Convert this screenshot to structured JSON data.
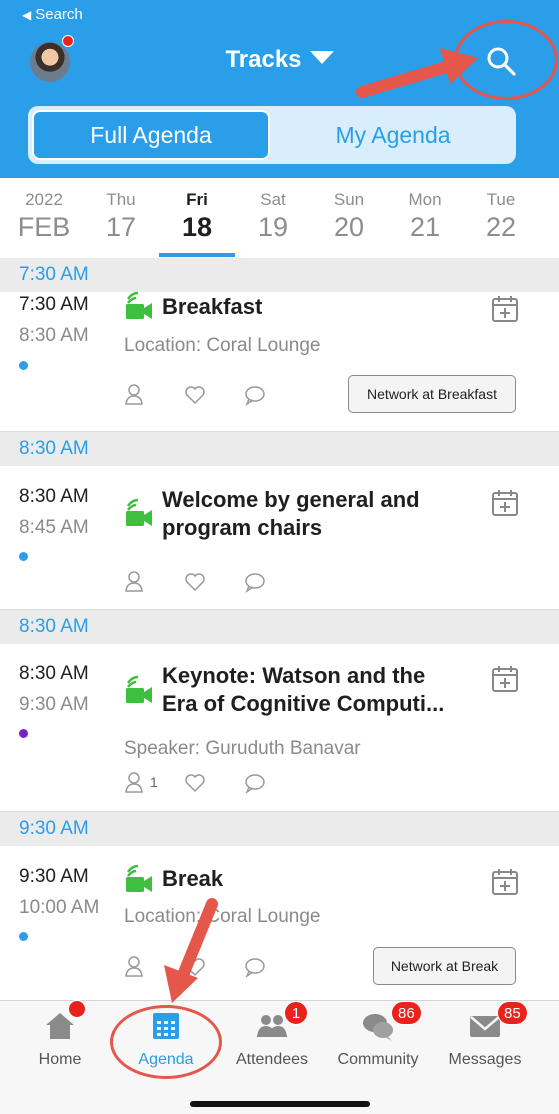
{
  "status": {
    "back_label": "Search"
  },
  "header": {
    "title": "Tracks"
  },
  "segments": {
    "full": "Full Agenda",
    "my": "My Agenda"
  },
  "dates": [
    {
      "dow": "2022",
      "num": "FEB",
      "active": false
    },
    {
      "dow": "Thu",
      "num": "17",
      "active": false
    },
    {
      "dow": "Fri",
      "num": "18",
      "active": true
    },
    {
      "dow": "Sat",
      "num": "19",
      "active": false
    },
    {
      "dow": "Sun",
      "num": "20",
      "active": false
    },
    {
      "dow": "Mon",
      "num": "21",
      "active": false
    },
    {
      "dow": "Tue",
      "num": "22",
      "active": false
    }
  ],
  "sessions": [
    {
      "header": "7:30 AM",
      "start": "7:30 AM",
      "end": "8:30 AM",
      "title_lines": [
        "Breakfast"
      ],
      "sub": "Location: Coral Lounge",
      "dot_color": "#2a9ee8",
      "attendee_count": "",
      "button": "Network at Breakfast"
    },
    {
      "header": "8:30 AM",
      "start": "8:30 AM",
      "end": "8:45 AM",
      "title_lines": [
        "Welcome by general and",
        "program chairs"
      ],
      "sub": "",
      "dot_color": "#2a9ee8",
      "attendee_count": "",
      "button": ""
    },
    {
      "header": "8:30 AM",
      "start": "8:30 AM",
      "end": "9:30 AM",
      "title_lines": [
        "Keynote: Watson and the",
        "Era of Cognitive Computi..."
      ],
      "sub": "Speaker: Guruduth Banavar",
      "dot_color": "#7b1fc9",
      "attendee_count": "1",
      "button": ""
    },
    {
      "header": "9:30 AM",
      "start": "9:30 AM",
      "end": "10:00 AM",
      "title_lines": [
        "Break"
      ],
      "sub": "Location: Coral Lounge",
      "dot_color": "#2a9ee8",
      "attendee_count": "",
      "button": "Network at Break"
    }
  ],
  "tabs": [
    {
      "label": "Home",
      "badge": "",
      "icon": "home-icon"
    },
    {
      "label": "Agenda",
      "badge": "",
      "icon": "calendar-icon"
    },
    {
      "label": "Attendees",
      "badge": "1",
      "icon": "attendees-icon"
    },
    {
      "label": "Community",
      "badge": "86",
      "icon": "chat-bubbles-icon"
    },
    {
      "label": "Messages",
      "badge": "85",
      "icon": "envelope-icon"
    }
  ],
  "colors": {
    "accent": "#2a9ee8",
    "badge": "#e8231b",
    "video": "#3fbf3f",
    "annotation": "#e5564b"
  }
}
